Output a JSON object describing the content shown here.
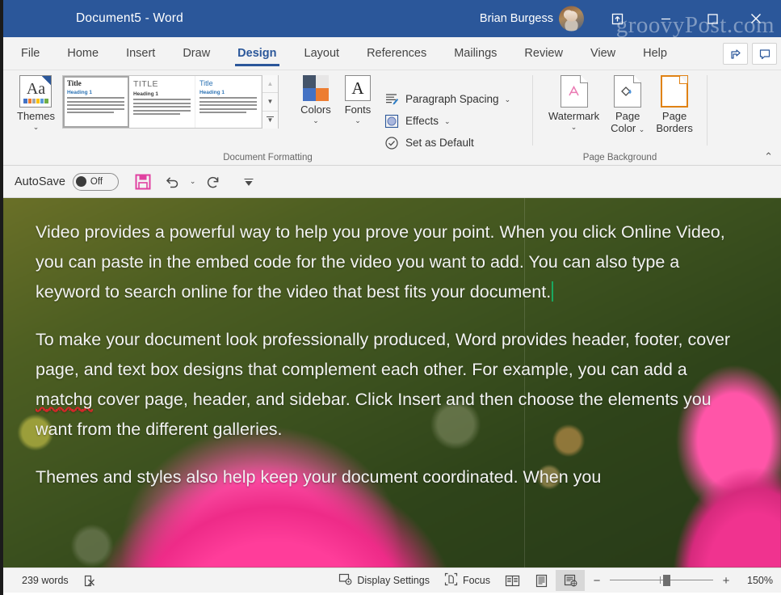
{
  "titlebar": {
    "document_title": "Document5  -  Word",
    "user_name": "Brian Burgess",
    "watermark": "groovyPost.com",
    "restore_up_icon": "restore-up-icon",
    "minimize_icon": "minimize-icon",
    "maximize_icon": "maximize-icon",
    "close_icon": "close-icon",
    "bg_color": "#2b579a"
  },
  "tabs": [
    {
      "label": "File"
    },
    {
      "label": "Home"
    },
    {
      "label": "Insert"
    },
    {
      "label": "Draw"
    },
    {
      "label": "Design",
      "active": true
    },
    {
      "label": "Layout"
    },
    {
      "label": "References"
    },
    {
      "label": "Mailings"
    },
    {
      "label": "Review"
    },
    {
      "label": "View"
    },
    {
      "label": "Help"
    }
  ],
  "tab_buttons": {
    "share_icon": "share-icon",
    "comments_icon": "comments-icon"
  },
  "ribbon": {
    "groups": [
      {
        "name": "Document Formatting",
        "label": "Document Formatting"
      },
      {
        "name": "Page Background",
        "label": "Page Background"
      }
    ],
    "themes": {
      "label": "Themes",
      "icon": "themes-icon",
      "chevron": "⌄",
      "swatch_colors": [
        "#4472c4",
        "#ed7d31",
        "#a5a5a5",
        "#ffc000",
        "#5b9bd5",
        "#70ad47"
      ]
    },
    "gallery": {
      "items": [
        {
          "title": "Title",
          "heading": "Heading 1",
          "style": "default",
          "selected": true
        },
        {
          "title": "TITLE",
          "heading": "Heading 1",
          "style": "caps"
        },
        {
          "title": "Title",
          "heading": "Heading 1",
          "style": "blue"
        }
      ],
      "scroll_up_icon": "chevron-up-icon",
      "scroll_down_icon": "chevron-down-icon",
      "more_icon": "gallery-more-icon"
    },
    "colors": {
      "label": "Colors",
      "chevron": "⌄",
      "quadrants": [
        "#44546a",
        "#e7e6e6",
        "#4472c4",
        "#ed7d31"
      ]
    },
    "fonts": {
      "label": "Fonts",
      "glyph": "A",
      "chevron": "⌄"
    },
    "paragraph_spacing": {
      "label": "Paragraph Spacing",
      "chevron": "⌄",
      "icon": "paragraph-spacing-icon"
    },
    "effects": {
      "label": "Effects",
      "chevron": "⌄",
      "icon": "effects-icon"
    },
    "set_as_default": {
      "label": "Set as Default",
      "icon": "set-as-default-icon"
    },
    "watermark": {
      "label": "Watermark",
      "chevron": "⌄",
      "icon": "watermark-icon",
      "accent": "#ea7ab3"
    },
    "page_color": {
      "label_line1": "Page",
      "label_line2": "Color",
      "chevron": "⌄",
      "icon": "page-color-icon"
    },
    "page_borders": {
      "label_line1": "Page",
      "label_line2": "Borders",
      "icon": "page-borders-icon",
      "accent": "#e08214"
    },
    "collapse_icon": "⌃"
  },
  "qat": {
    "autosave_label": "AutoSave",
    "autosave_state": "Off",
    "save_icon": "save-icon",
    "save_color": "#e040a0",
    "undo_icon": "undo-icon",
    "undo_chevron": "⌄",
    "redo_icon": "redo-icon",
    "customize_icon": "customize-quick-access-icon"
  },
  "document": {
    "paragraphs": [
      {
        "before": "Video provides a powerful way to help you prove your point. When you click Online Video, you can paste in the embed code for the video you want to add. You can also type a keyword to search online for the video that best fits your document.",
        "caret": true
      },
      {
        "part1": "To make your document look professionally produced, Word provides header, footer, cover page, and text box designs that complement each other. For example, you can add a ",
        "misspelled": "matchg",
        "part2": " cover page, header, and sidebar. Click Insert and then choose the elements you want from the different galleries."
      },
      {
        "before": "Themes and styles also help keep your document coordinated. When you"
      }
    ],
    "background": "pink-dahlia-flower-photo"
  },
  "statusbar": {
    "word_count": "239 words",
    "proofing_icon": "proofing-errors-icon",
    "display_settings": {
      "label": "Display Settings",
      "icon": "display-settings-icon"
    },
    "focus": {
      "label": "Focus",
      "icon": "focus-mode-icon"
    },
    "views": [
      {
        "name": "read-mode",
        "icon": "read-mode-icon",
        "active": false
      },
      {
        "name": "print-layout",
        "icon": "print-layout-icon",
        "active": false
      },
      {
        "name": "web-layout",
        "icon": "web-layout-icon",
        "active": true
      }
    ],
    "zoom_out": "−",
    "zoom_in": "+",
    "zoom_level": "150%"
  }
}
